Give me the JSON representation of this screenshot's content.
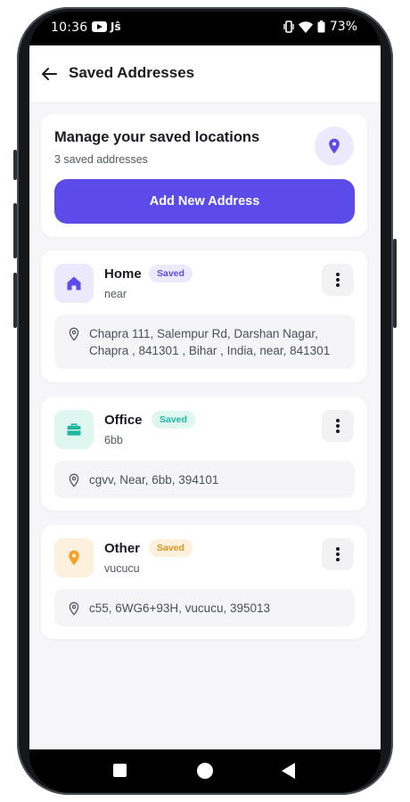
{
  "status": {
    "time": "10:36",
    "app_badge": "Jŝ",
    "battery": "73%"
  },
  "appbar": {
    "title": "Saved Addresses"
  },
  "header": {
    "title": "Manage your saved locations",
    "count_text": "3 saved addresses",
    "add_button": "Add New Address"
  },
  "addresses": [
    {
      "name": "Home",
      "badge": "Saved",
      "subtitle": "near",
      "address": "Chapra 111, Salempur Rd, Darshan Nagar, Chapra , 841301 , Bihar , India, near, 841301",
      "icon": "home-icon",
      "accent": "#5b4cea"
    },
    {
      "name": "Office",
      "badge": "Saved",
      "subtitle": "6bb",
      "address": "cgvv, Near, 6bb, 394101",
      "icon": "briefcase-icon",
      "accent": "#1fb7a0"
    },
    {
      "name": "Other",
      "badge": "Saved",
      "subtitle": "vucucu",
      "address": "c55, 6WG6+93H, vucucu, 395013",
      "icon": "location-pin-icon",
      "accent": "#f4a22a"
    }
  ],
  "colors": {
    "primary": "#5b4cea",
    "background": "#f6f6f9"
  }
}
